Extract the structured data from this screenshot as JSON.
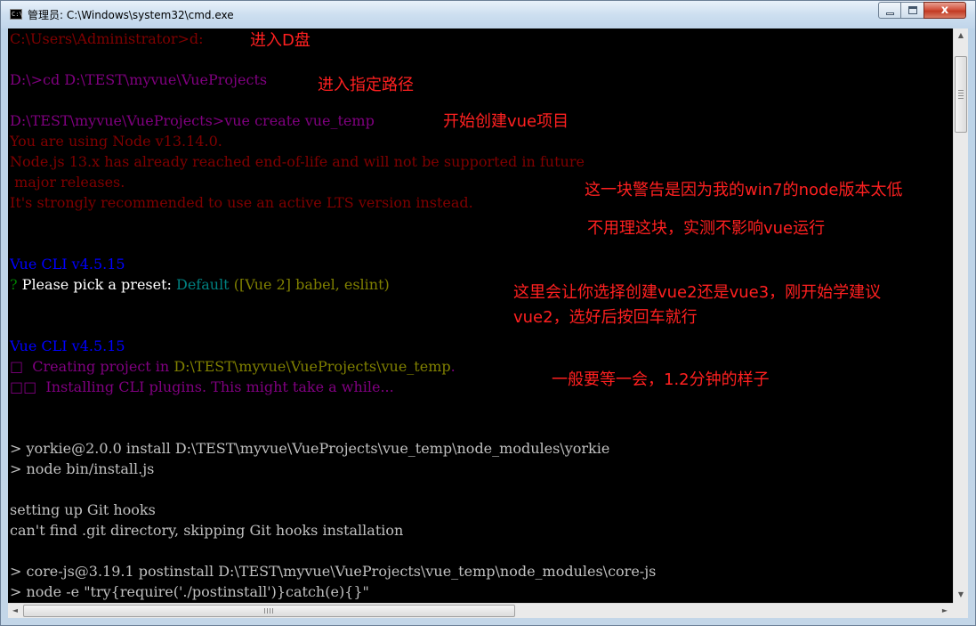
{
  "window": {
    "title": "管理员: C:\\Windows\\system32\\cmd.exe",
    "icon": "cmd-icon",
    "close_glyph": "x"
  },
  "console_lines": [
    {
      "segments": [
        {
          "text": "C:\\Users\\Administrator>d:",
          "color": "#800000"
        }
      ]
    },
    {
      "segments": [
        {
          "text": "D:\\>cd D:\\TEST\\myvue\\VueProjects",
          "color": "#800080"
        }
      ]
    },
    {
      "segments": [
        {
          "text": "D:\\TEST\\myvue\\VueProjects>vue create vue_temp",
          "color": "#800080"
        }
      ]
    },
    {
      "segments": [
        {
          "text": "You are using Node v13.14.0.",
          "color": "#800000"
        }
      ]
    },
    {
      "segments": [
        {
          "text": "Node.js 13.x has already reached end-of-life and will not be supported in future",
          "color": "#800000"
        }
      ]
    },
    {
      "segments": [
        {
          "text": " major releases.",
          "color": "#800000"
        }
      ]
    },
    {
      "segments": [
        {
          "text": "It's strongly recommended to use an active LTS version instead.",
          "color": "#800000"
        }
      ]
    },
    {
      "segments": [
        {
          "text": "Vue CLI v4.5.15",
          "color": "#0000ff"
        }
      ]
    },
    {
      "segments": [
        {
          "text": "? ",
          "color": "#008000"
        },
        {
          "text": "Please pick a preset: ",
          "color": "#ffffff"
        },
        {
          "text": "Default ",
          "color": "#008080"
        },
        {
          "text": "([Vue 2] babel, eslint)",
          "color": "#808000"
        }
      ]
    },
    {
      "segments": [
        {
          "text": "Vue CLI v4.5.15",
          "color": "#0000ff"
        }
      ]
    },
    {
      "segments": [
        {
          "text": "□  Creating project in ",
          "color": "#800080"
        },
        {
          "text": "D:\\TEST\\myvue\\VueProjects\\vue_temp",
          "color": "#808000"
        },
        {
          "text": ".",
          "color": "#800080"
        }
      ]
    },
    {
      "segments": [
        {
          "text": "□□  Installing CLI plugins. This might take a while...",
          "color": "#800080"
        }
      ]
    },
    {
      "segments": [
        {
          "text": "> yorkie@2.0.0 install D:\\TEST\\myvue\\VueProjects\\vue_temp\\node_modules\\yorkie",
          "color": "#c0c0c0"
        }
      ]
    },
    {
      "segments": [
        {
          "text": "> node bin/install.js",
          "color": "#c0c0c0"
        }
      ]
    },
    {
      "segments": [
        {
          "text": "setting up Git hooks",
          "color": "#c0c0c0"
        }
      ]
    },
    {
      "segments": [
        {
          "text": "can't find .git directory, skipping Git hooks installation",
          "color": "#c0c0c0"
        }
      ]
    },
    {
      "segments": [
        {
          "text": "> core-js@3.19.1 postinstall D:\\TEST\\myvue\\VueProjects\\vue_temp\\node_modules\\core-js",
          "color": "#c0c0c0"
        }
      ]
    },
    {
      "segments": [
        {
          "text": "> node -e \"try{require('./postinstall')}catch(e){}\"",
          "color": "#c0c0c0"
        }
      ]
    }
  ],
  "annotations": [
    "进入D盘",
    "进入指定路径",
    "开始创建vue项目",
    "这一块警告是因为我的win7的node版本太低",
    "不用理这块，实测不影响vue运行",
    "这里会让你选择创建vue2还是vue3，刚开始学建议",
    "vue2，选好后按回车就行",
    "一般要等一会，1.2分钟的样子"
  ],
  "colors": {
    "annotation": "#ff2020",
    "console_bg": "#000000"
  },
  "scrollbars": {
    "vertical": {
      "up": "▲",
      "down": "▼"
    },
    "horizontal": {
      "left": "◄",
      "right": "►"
    }
  }
}
